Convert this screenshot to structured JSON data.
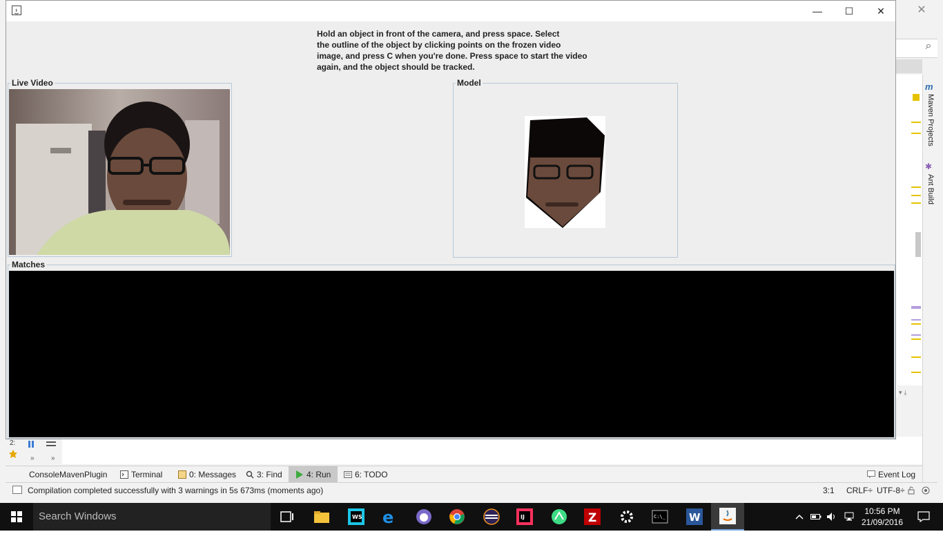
{
  "app_window": {
    "instructions": "Hold an object in front of the camera, and press space. Select the outline of the object by clicking points on the frozen video image, and press C when you're done. Press space to start the video again, and the object should be tracked.",
    "instruction_lines": [
      "Hold an object in front of the camera, and press space. Select",
      "the outline of the object by clicking points on the frozen video",
      "image, and press C when you're done. Press space to start the video",
      "again, and the object should be tracked."
    ],
    "panels": {
      "live_video": "Live Video",
      "model": "Model",
      "matches": "Matches"
    },
    "window_controls": {
      "minimize": "—",
      "maximize": "☐",
      "close": "✕"
    }
  },
  "ide": {
    "close_glyph": "✕",
    "search_glyph": "⌕",
    "side_tabs": [
      "Maven Projects",
      "Ant Build"
    ],
    "side_tab_icons": [
      "m",
      "✱"
    ],
    "tool_tabs": [
      {
        "label": "ConsoleMavenPlugin",
        "icon": "none",
        "active": false
      },
      {
        "label": "Terminal",
        "icon": "terminal-icon",
        "active": false
      },
      {
        "label": "0: Messages",
        "icon": "messages-icon",
        "active": false
      },
      {
        "label": "3: Find",
        "icon": "find-icon",
        "active": false
      },
      {
        "label": "4: Run",
        "icon": "run-icon",
        "active": true
      },
      {
        "label": "6: TODO",
        "icon": "todo-icon",
        "active": false
      }
    ],
    "event_log": "Event Log",
    "status": {
      "message": "Compilation completed successfully with 3 warnings in 5s 673ms (moments ago)",
      "position": "3:1",
      "line_sep": "CRLF÷",
      "encoding": "UTF-8÷"
    },
    "left_tools_labels": [
      "2:",
      "»",
      "»"
    ],
    "accent_colors": {
      "marker_yellow": "#e6c300",
      "marker_purple": "#b39ddb"
    }
  },
  "taskbar": {
    "search_placeholder": "Search Windows",
    "apps": [
      "task-view",
      "file-explorer",
      "webstorm",
      "edge",
      "github",
      "chrome",
      "eclipse",
      "intellij",
      "android-studio",
      "filezilla",
      "settings",
      "cmd",
      "word",
      "java"
    ],
    "clock_time": "10:56 PM",
    "clock_date": "21/09/2016"
  }
}
